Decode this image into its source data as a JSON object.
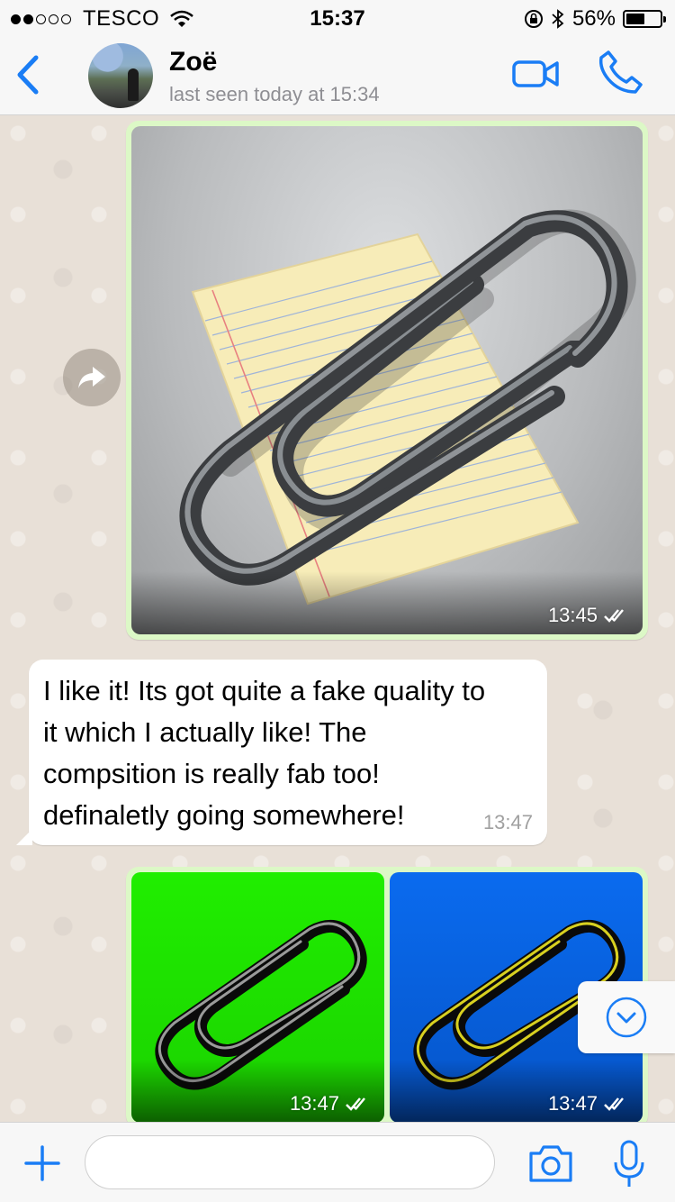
{
  "status_bar": {
    "carrier": "TESCO",
    "time": "15:37",
    "battery_percent": "56%",
    "battery_level": 0.56,
    "signal_bars_filled": 2,
    "signal_bars_total": 5
  },
  "header": {
    "contact_name": "Zoë",
    "last_seen": "last seen today at 15:34",
    "accent_color": "#1a7df5"
  },
  "messages": [
    {
      "direction": "outgoing",
      "type": "image",
      "image": "paperclip-on-notepad",
      "time": "13:45",
      "status": "read"
    },
    {
      "direction": "incoming",
      "type": "text",
      "lines": [
        "I like it! Its got quite a fake quality to",
        "it which I actually like! The",
        "compsition is really fab too!",
        "definaletly going somewhere!"
      ],
      "time": "13:47"
    },
    {
      "direction": "outgoing",
      "type": "image",
      "image": "paperclip-green-background",
      "background_color": "#20ee00",
      "time": "13:47",
      "status": "read"
    },
    {
      "direction": "outgoing",
      "type": "image",
      "image": "paperclip-blue-background",
      "background_color": "#0a6bef",
      "time": "13:47",
      "status": "read"
    }
  ],
  "composer": {
    "placeholder": "",
    "value": ""
  },
  "colors": {
    "outgoing_bubble": "#dcf8c6",
    "incoming_bubble": "#ffffff",
    "chat_background": "#e8e0d7"
  },
  "icons": [
    "back-chevron-icon",
    "video-camera-icon",
    "phone-icon",
    "forward-icon",
    "double-check-icon",
    "chevron-down-icon",
    "plus-icon",
    "camera-icon",
    "microphone-icon"
  ]
}
